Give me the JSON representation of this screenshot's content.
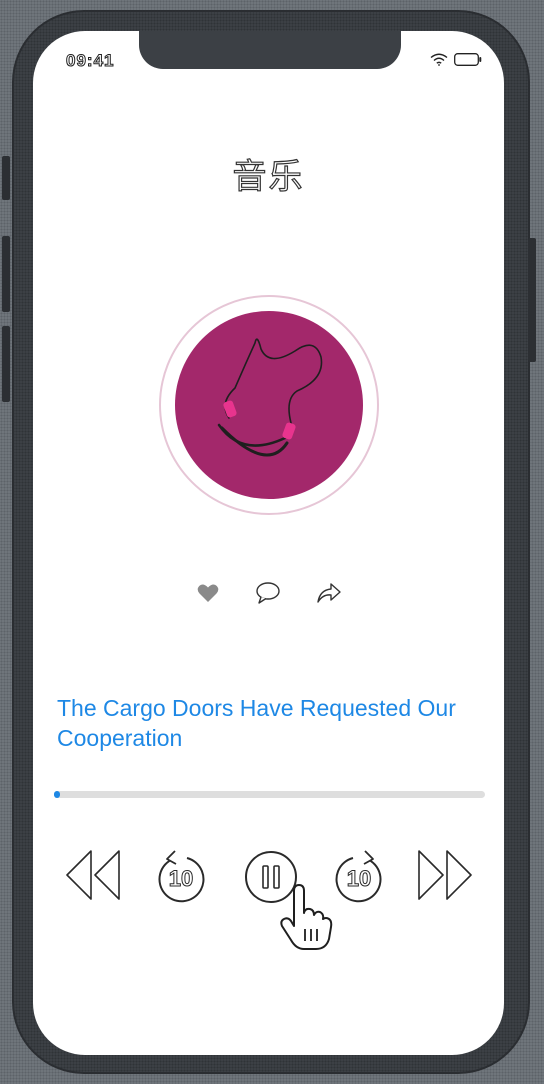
{
  "status_bar": {
    "time": "09:41"
  },
  "header": {
    "title": "音乐"
  },
  "album": {
    "icon": "headphones-smile-icon",
    "color": "#a3286b"
  },
  "actions": [
    {
      "icon": "heart-icon"
    },
    {
      "icon": "comment-icon"
    },
    {
      "icon": "share-icon"
    }
  ],
  "song": {
    "title": "The Cargo Doors Have Requested Our Cooperation"
  },
  "progress": {
    "fraction": 0.01,
    "color": "#1e88e5"
  },
  "controls": {
    "rewind": "rewind-icon",
    "skip_back_seconds": "10",
    "play_pause": "pause-icon",
    "skip_forward_seconds": "10",
    "fast_forward": "fast-forward-icon"
  }
}
